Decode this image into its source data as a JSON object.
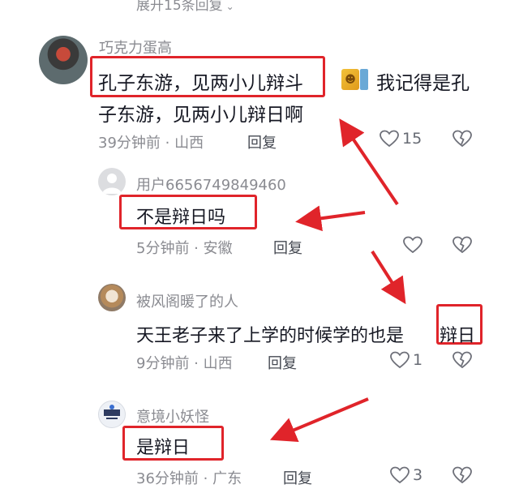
{
  "thread": {
    "expand_label": "展开15条回复",
    "expand_icon": "chevron-down-icon"
  },
  "comments": [
    {
      "username": "巧克力蛋高",
      "line1_boxed": "孔子东游，见两小儿辩斗",
      "line1_tail": "我记得是孔",
      "line2": "子东游，见两小儿辩日啊",
      "time_location": "39分钟前 · 山西",
      "reply_label": "回复",
      "likes": "15"
    },
    {
      "username": "用户6656749849460",
      "text": "不是辩日吗",
      "time_location": "5分钟前 · 安徽",
      "reply_label": "回复",
      "likes": ""
    },
    {
      "username": "被风阁暖了的人",
      "text_main": "天王老子来了上学的时候学的也是",
      "text_boxed": "辩日",
      "time_location": "9分钟前 · 山西",
      "reply_label": "回复",
      "likes": "1"
    },
    {
      "username": "意境小妖怪",
      "text": "是辩日",
      "time_location": "36分钟前 · 广东",
      "reply_label": "回复",
      "likes": "3"
    }
  ],
  "colors": {
    "annotation_red": "#e0242a",
    "meta_gray": "#8a8b91",
    "text_dark": "#161823"
  }
}
